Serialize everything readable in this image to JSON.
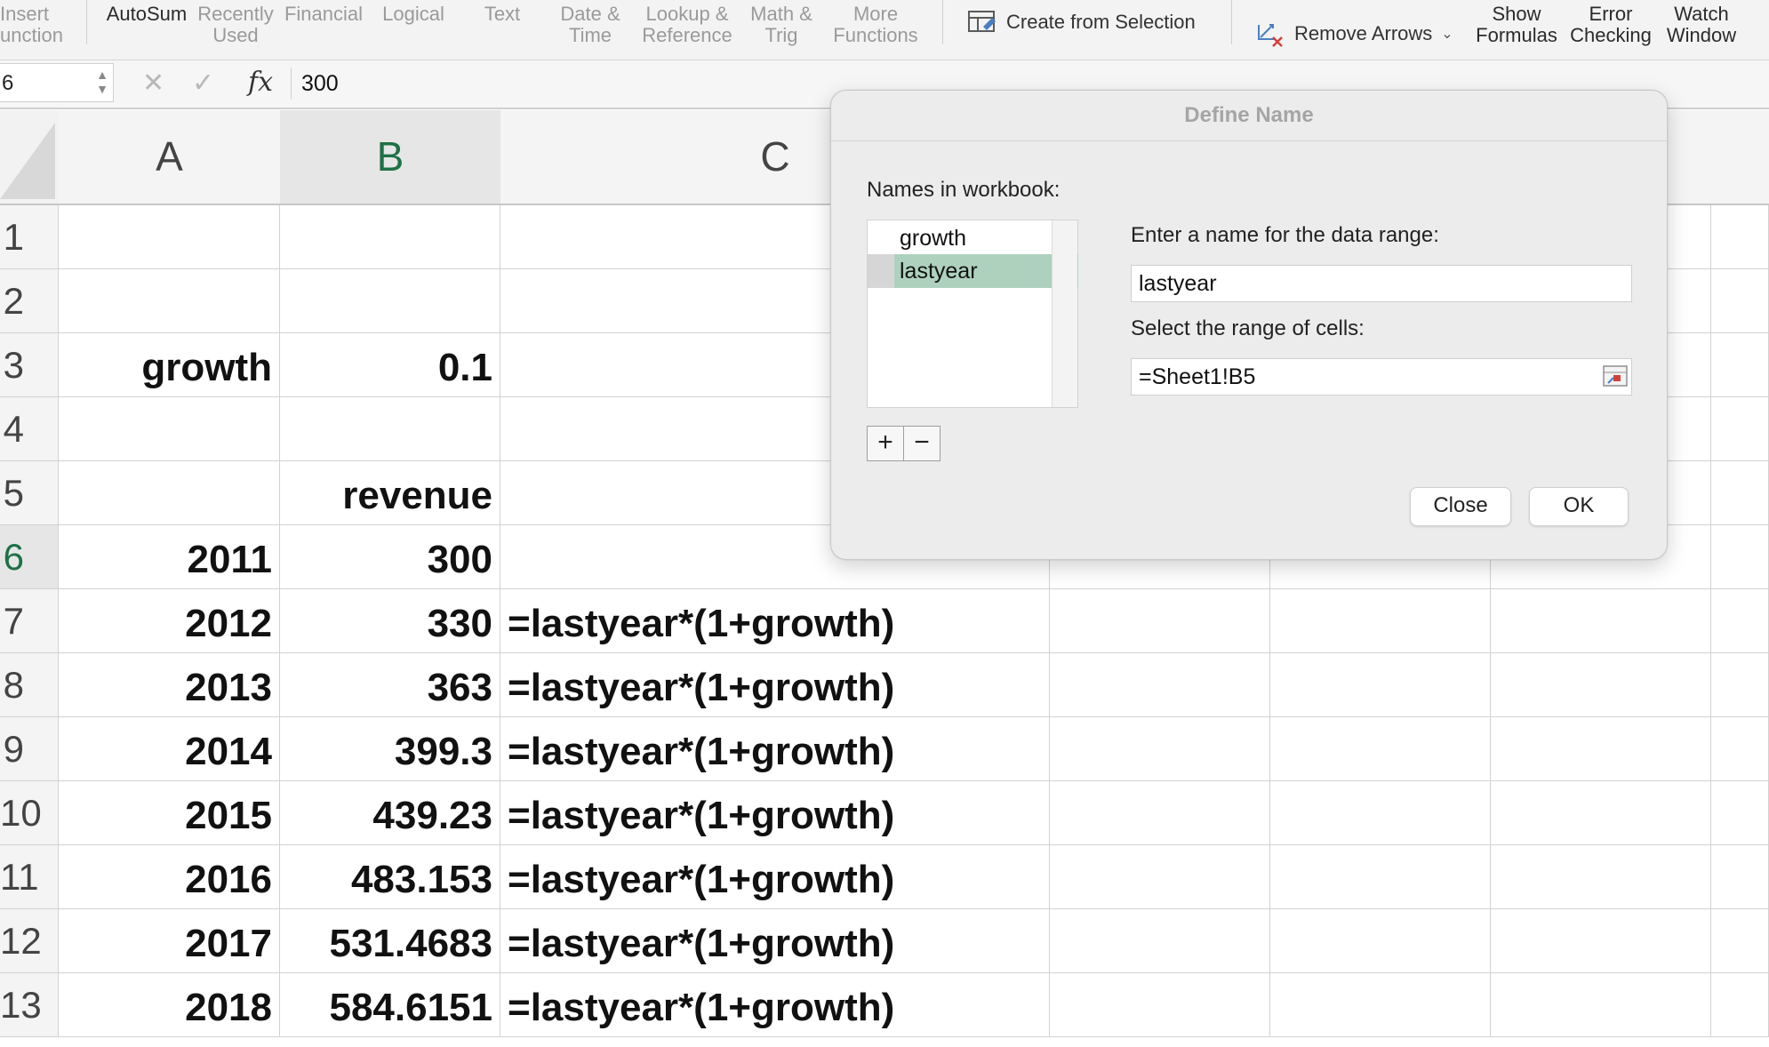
{
  "ribbon": {
    "buttons": [
      {
        "id": "insert-function",
        "label": "Insert\nunction"
      },
      {
        "id": "autosum",
        "label": "AutoSum"
      },
      {
        "id": "recently-used",
        "label": "Recently\nUsed"
      },
      {
        "id": "financial",
        "label": "Financial"
      },
      {
        "id": "logical",
        "label": "Logical"
      },
      {
        "id": "text",
        "label": "Text"
      },
      {
        "id": "date-time",
        "label": "Date &\nTime"
      },
      {
        "id": "lookup-reference",
        "label": "Lookup &\nReference"
      },
      {
        "id": "math-trig",
        "label": "Math &\nTrig"
      },
      {
        "id": "more-functions",
        "label": "More\nFunctions"
      },
      {
        "id": "show-formulas",
        "label": "Show\nFormulas"
      },
      {
        "id": "error-checking",
        "label": "Error\nChecking"
      },
      {
        "id": "watch-window",
        "label": "Watch\nWindow"
      }
    ],
    "create_from_selection": "Create from Selection",
    "remove_arrows": "Remove Arrows"
  },
  "formula_bar": {
    "name_box": "6",
    "fx_label": "fx",
    "formula": "300"
  },
  "grid": {
    "columns": [
      "A",
      "B",
      "C"
    ],
    "selected_column": "B",
    "selected_row": "6",
    "rows": [
      {
        "num": "1",
        "a": "",
        "b": "",
        "c": ""
      },
      {
        "num": "2",
        "a": "",
        "b": "",
        "c": ""
      },
      {
        "num": "3",
        "a": "growth",
        "b": "0.1",
        "c": ""
      },
      {
        "num": "4",
        "a": "",
        "b": "",
        "c": ""
      },
      {
        "num": "5",
        "a": "",
        "b": "revenue",
        "c": ""
      },
      {
        "num": "6",
        "a": "2011",
        "b": "300",
        "c": ""
      },
      {
        "num": "7",
        "a": "2012",
        "b": "330",
        "c": "=lastyear*(1+growth)"
      },
      {
        "num": "8",
        "a": "2013",
        "b": "363",
        "c": "=lastyear*(1+growth)"
      },
      {
        "num": "9",
        "a": "2014",
        "b": "399.3",
        "c": "=lastyear*(1+growth)"
      },
      {
        "num": "10",
        "a": "2015",
        "b": "439.23",
        "c": "=lastyear*(1+growth)"
      },
      {
        "num": "11",
        "a": "2016",
        "b": "483.153",
        "c": "=lastyear*(1+growth)"
      },
      {
        "num": "12",
        "a": "2017",
        "b": "531.4683",
        "c": "=lastyear*(1+growth)"
      },
      {
        "num": "13",
        "a": "2018",
        "b": "584.6151",
        "c": "=lastyear*(1+growth)"
      }
    ]
  },
  "dialog": {
    "title": "Define Name",
    "names_label": "Names in workbook:",
    "names": [
      "growth",
      "lastyear"
    ],
    "selected_name": "lastyear",
    "name_prompt": "Enter a name for the data range:",
    "name_value": "lastyear",
    "range_prompt": "Select the range of cells:",
    "range_value": "=Sheet1!B5",
    "add_label": "+",
    "remove_label": "−",
    "close_label": "Close",
    "ok_label": "OK"
  },
  "colors": {
    "selected_header_text": "#1e7145",
    "selected_name_bg": "#aed1bd",
    "dialog_bg": "#ececec"
  }
}
